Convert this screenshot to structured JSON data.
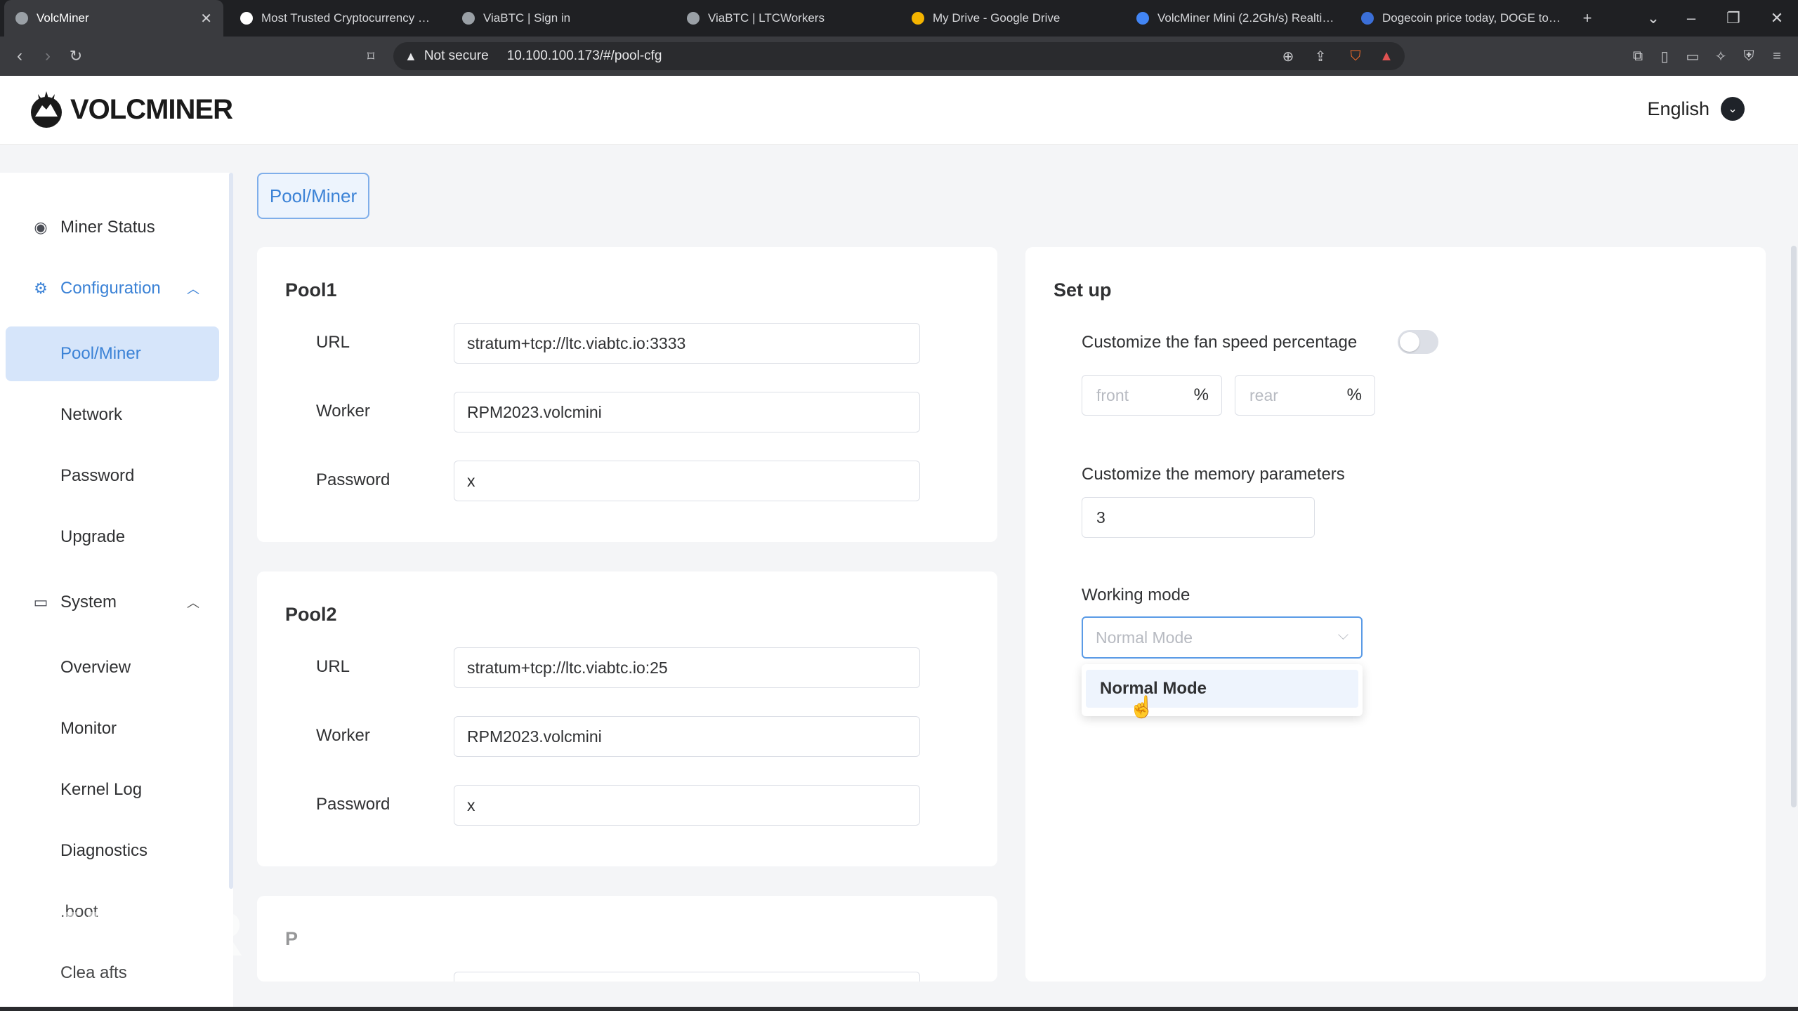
{
  "browser": {
    "tabs": [
      {
        "label": "VolcMiner",
        "color": "#9aa0a6"
      },
      {
        "label": "Most Trusted Cryptocurrency Mining",
        "color": "#ffffff"
      },
      {
        "label": "ViaBTC | Sign in",
        "color": "#9aa0a6"
      },
      {
        "label": "ViaBTC | LTCWorkers",
        "color": "#9aa0a6"
      },
      {
        "label": "My Drive - Google Drive",
        "color": "#f4b400"
      },
      {
        "label": "VolcMiner Mini (2.2Gh/s) Realtime P",
        "color": "#4285f4"
      },
      {
        "label": "Dogecoin price today, DOGE to USD",
        "color": "#3b6fd8"
      }
    ],
    "new_tab": "+",
    "security": "Not secure",
    "url": "10.100.100.173/#/pool-cfg"
  },
  "header": {
    "brand": "VOLCMINER",
    "language": "English"
  },
  "sidebar": {
    "miner_status": "Miner Status",
    "configuration": {
      "label": "Configuration",
      "items": [
        "Pool/Miner",
        "Network",
        "Password",
        "Upgrade"
      ]
    },
    "system": {
      "label": "System",
      "items": [
        "Overview",
        "Monitor",
        "Kernel Log",
        "Diagnostics",
        ".boot",
        "Clea  afts"
      ]
    }
  },
  "breadcrumb": "Pool/Miner",
  "pools": [
    {
      "title": "Pool1",
      "url_label": "URL",
      "url": "stratum+tcp://ltc.viabtc.io:3333",
      "worker_label": "Worker",
      "worker": "RPM2023.volcmini",
      "password_label": "Password",
      "password": "x"
    },
    {
      "title": "Pool2",
      "url_label": "URL",
      "url": "stratum+tcp://ltc.viabtc.io:25",
      "worker_label": "Worker",
      "worker": "RPM2023.volcmini",
      "password_label": "Password",
      "password": "x"
    }
  ],
  "pool3_title": "P   ",
  "setup": {
    "title": "Set up",
    "fan_label": "Customize the fan speed percentage",
    "fan_enabled": false,
    "front_placeholder": "front",
    "rear_placeholder": "rear",
    "percent_unit": "%",
    "memory_label": "Customize the memory parameters",
    "memory_value": "3",
    "mode_label": "Working mode",
    "mode_placeholder": "Normal Mode",
    "mode_options": [
      "Normal Mode"
    ]
  },
  "watermark": "MINER"
}
